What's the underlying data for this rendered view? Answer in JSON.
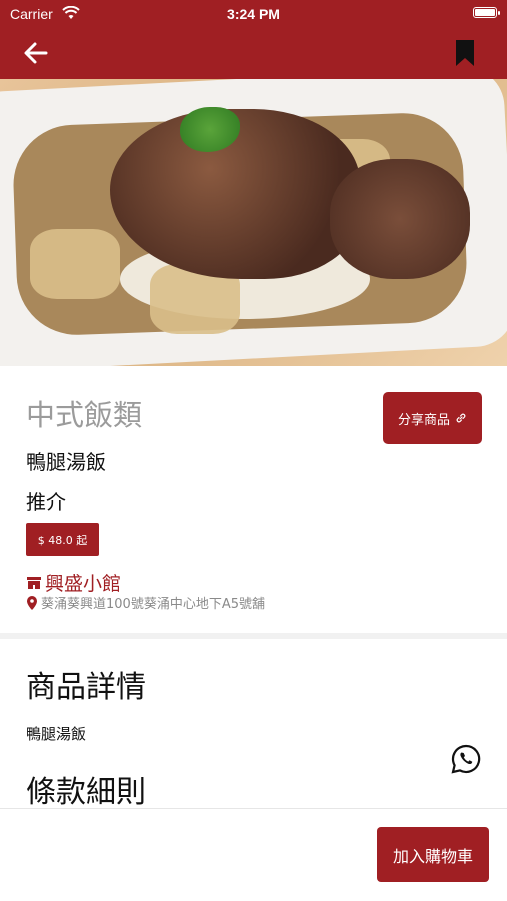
{
  "status_bar": {
    "carrier": "Carrier",
    "time": "3:24 PM"
  },
  "nav": {
    "back_icon": "arrow-left-icon",
    "bookmark_icon": "bookmark-icon"
  },
  "product": {
    "category": "中式飯類",
    "name": "鴨腿湯飯",
    "recommend": "推介",
    "price": "$ 48.0 起",
    "share_label": "分享商品",
    "shop_name": "興盛小館",
    "address": "葵涌葵興道100號葵涌中心地下A5號舖"
  },
  "sections": {
    "details_title": "商品詳情",
    "details_text": "鴨腿湯飯",
    "terms_title": "條款細則"
  },
  "actions": {
    "add_to_cart": "加入購物車"
  },
  "colors": {
    "brand": "#a01f23",
    "muted": "#9b9b9b"
  }
}
